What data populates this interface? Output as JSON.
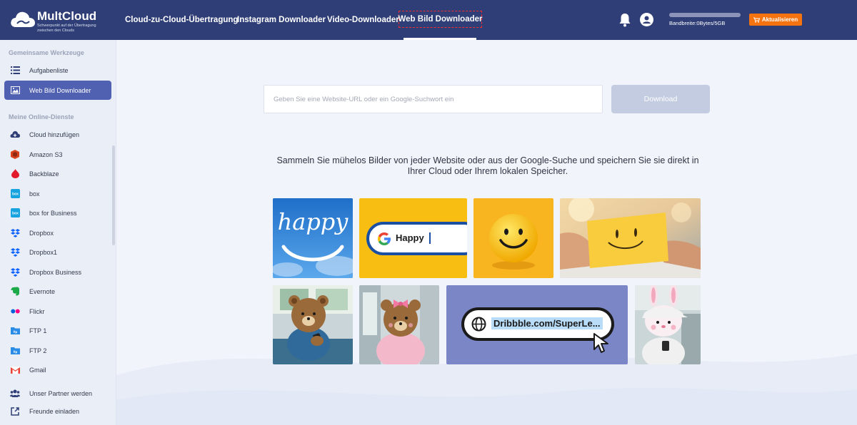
{
  "header": {
    "logo": {
      "name": "MultCloud",
      "tagline": "Schwerpunkt auf der Übertragung zwischen den Clouds"
    },
    "nav": [
      {
        "label": "Cloud-zu-Cloud-Übertragung"
      },
      {
        "label": "Instagram Downloader"
      },
      {
        "label": "Video-Downloader"
      },
      {
        "label": "Web Bild Downloader",
        "active": true
      }
    ],
    "bandwidth": "Bandbreite:0Bytes/5GB",
    "upgrade_label": "Aktualisieren",
    "icons": [
      "bell-icon",
      "user-icon",
      "cart-icon"
    ]
  },
  "sidebar": {
    "section_tools": "Gemeinsame Werkzeuge",
    "tools": [
      {
        "label": "Aufgabenliste",
        "icon": "list-icon"
      },
      {
        "label": "Web Bild Downloader",
        "icon": "image-icon",
        "active": true
      }
    ],
    "section_services": "Meine Online-Dienste",
    "services": [
      {
        "label": "Cloud hinzufügen",
        "icon": "cloud-add-icon"
      },
      {
        "label": "Amazon S3",
        "icon": "amazon-s3-icon"
      },
      {
        "label": "Backblaze",
        "icon": "backblaze-icon"
      },
      {
        "label": "box",
        "icon": "box-icon"
      },
      {
        "label": "box for Business",
        "icon": "box-icon"
      },
      {
        "label": "Dropbox",
        "icon": "dropbox-icon"
      },
      {
        "label": "Dropbox1",
        "icon": "dropbox-icon"
      },
      {
        "label": "Dropbox Business",
        "icon": "dropbox-icon"
      },
      {
        "label": "Evernote",
        "icon": "evernote-icon"
      },
      {
        "label": "Flickr",
        "icon": "flickr-icon"
      },
      {
        "label": "FTP 1",
        "icon": "ftp-icon"
      },
      {
        "label": "FTP 2",
        "icon": "ftp-icon"
      },
      {
        "label": "Gmail",
        "icon": "gmail-icon"
      }
    ],
    "footer": [
      {
        "label": "Unser Partner werden",
        "icon": "partner-icon"
      },
      {
        "label": "Freunde einladen",
        "icon": "invite-icon"
      }
    ]
  },
  "main": {
    "url_placeholder": "Geben Sie eine Website-URL oder ein Google-Suchwort ein",
    "download_label": "Download",
    "description": "Sammeln Sie mühelos Bilder von jeder Website oder aus der Google-Suche und speichern Sie sie direkt in Ihrer Cloud oder Ihrem lokalen Speicher.",
    "gallery": {
      "happy_text": "happy",
      "search_text": "Happy",
      "url_text": "Dribbble.com/SuperLe..."
    }
  },
  "colors": {
    "header_bg": "#2f3e76",
    "accent": "#5161b2",
    "upgrade": "#f5740f",
    "highlight_border": "#ff2d2d"
  }
}
